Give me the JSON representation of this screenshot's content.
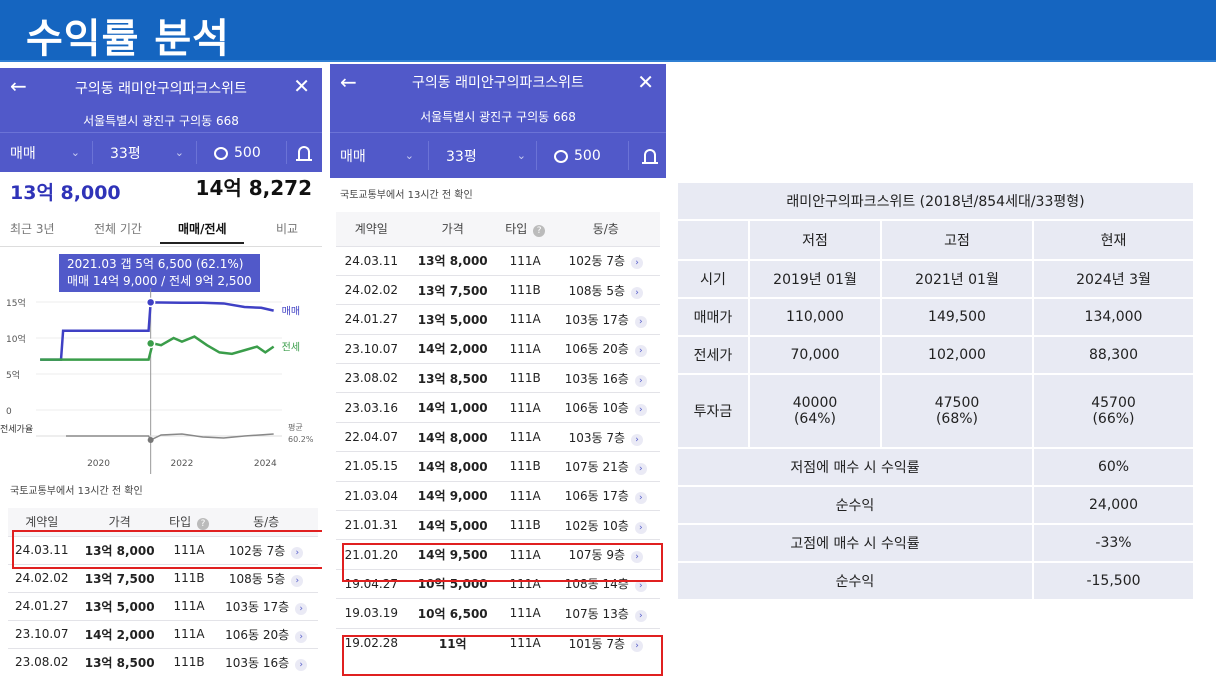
{
  "slide": {
    "title": "수익률 분석"
  },
  "left_panel": {
    "back_icon": "←",
    "close_icon": "✕",
    "complex_name": "구의동 래미안구의파크스위트",
    "address": "서울특별시 광진구 구의동 668",
    "filter_type": "매매",
    "filter_size": "33평",
    "comment_count": "500",
    "sale_price": "13억 8,000",
    "jeonse_price": "14억 8,272",
    "tabs": [
      "최근 3년",
      "전체 기간",
      "매매/전세",
      "비교"
    ],
    "tooltip_line1": "2021.03  갭 5억 6,500 (62.1%)",
    "tooltip_line2": "매매 14억 9,000 / 전세 9억 2,500",
    "source": "국토교통부에서 13시간 전 확인"
  },
  "chart_data": {
    "type": "line",
    "y_ticks": [
      "15억",
      "10억",
      "5억",
      "0"
    ],
    "x_ticks": [
      "2020",
      "2022",
      "2024"
    ],
    "ylim": [
      0,
      15
    ],
    "series": [
      {
        "name": "매매",
        "color": "#3f40c4",
        "x": [
          2018.6,
          2019.1,
          2019.15,
          2020.2,
          2020.25,
          2021.0,
          2021.2,
          2021.25,
          2022.0,
          2022.5,
          2023.0,
          2023.5,
          2023.9,
          2024.2
        ],
        "values": [
          7.0,
          7.0,
          11.0,
          11.0,
          11.0,
          11.0,
          11.0,
          14.95,
          14.9,
          14.9,
          14.8,
          14.3,
          14.2,
          13.8
        ]
      },
      {
        "name": "전세",
        "color": "#3a9d4a",
        "x": [
          2018.6,
          2019.0,
          2019.5,
          2020.0,
          2020.5,
          2021.0,
          2021.2,
          2021.3,
          2021.5,
          2021.8,
          2022.0,
          2022.3,
          2022.6,
          2022.9,
          2023.2,
          2023.5,
          2023.8,
          2024.0,
          2024.2
        ],
        "values": [
          7.0,
          7.0,
          7.0,
          7.0,
          7.0,
          7.0,
          7.0,
          9.25,
          9.0,
          10.0,
          9.5,
          10.2,
          9.0,
          8.0,
          7.8,
          8.3,
          8.8,
          8.0,
          8.8
        ]
      }
    ],
    "ratio_label": "전세가율",
    "ratio_avg_label": "평균",
    "ratio_avg_value": "60.2%"
  },
  "left_table": {
    "headers": [
      "계약일",
      "가격",
      "타입",
      "동/층"
    ],
    "rows": [
      {
        "date": "24.03.11",
        "price": "13억 8,000",
        "type": "111A",
        "unit": "102동 7층"
      },
      {
        "date": "24.02.02",
        "price": "13억 7,500",
        "type": "111B",
        "unit": "108동 5층"
      },
      {
        "date": "24.01.27",
        "price": "13억 5,000",
        "type": "111A",
        "unit": "103동 17층"
      },
      {
        "date": "23.10.07",
        "price": "14억 2,000",
        "type": "111A",
        "unit": "106동 20층"
      },
      {
        "date": "23.08.02",
        "price": "13억 8,500",
        "type": "111B",
        "unit": "103동 16층"
      }
    ]
  },
  "mid_panel": {
    "back_icon": "←",
    "close_icon": "✕",
    "complex_name": "구의동 래미안구의파크스위트",
    "address": "서울특별시 광진구 구의동 668",
    "filter_type": "매매",
    "filter_size": "33평",
    "comment_count": "500",
    "source": "국토교통부에서 13시간 전 확인",
    "headers": [
      "계약일",
      "가격",
      "타입",
      "동/층"
    ],
    "rows": [
      {
        "date": "24.03.11",
        "price": "13억 8,000",
        "type": "111A",
        "unit": "102동 7층"
      },
      {
        "date": "24.02.02",
        "price": "13억 7,500",
        "type": "111B",
        "unit": "108동 5층"
      },
      {
        "date": "24.01.27",
        "price": "13억 5,000",
        "type": "111A",
        "unit": "103동 17층"
      },
      {
        "date": "23.10.07",
        "price": "14억 2,000",
        "type": "111A",
        "unit": "106동 20층"
      },
      {
        "date": "23.08.02",
        "price": "13억 8,500",
        "type": "111B",
        "unit": "103동 16층"
      },
      {
        "date": "23.03.16",
        "price": "14억 1,000",
        "type": "111A",
        "unit": "106동 10층"
      },
      {
        "date": "22.04.07",
        "price": "14억 8,000",
        "type": "111A",
        "unit": "103동 7층"
      },
      {
        "date": "21.05.15",
        "price": "14억 8,000",
        "type": "111B",
        "unit": "107동 21층"
      },
      {
        "date": "21.03.04",
        "price": "14억 9,000",
        "type": "111A",
        "unit": "106동 17층"
      },
      {
        "date": "21.01.31",
        "price": "14억 5,000",
        "type": "111B",
        "unit": "102동 10층"
      },
      {
        "date": "21.01.20",
        "price": "14억 9,500",
        "type": "111A",
        "unit": "107동 9층"
      },
      {
        "date": "19.04.27",
        "price": "10억 5,000",
        "type": "111A",
        "unit": "108동 14층"
      },
      {
        "date": "19.03.19",
        "price": "10억 6,500",
        "type": "111A",
        "unit": "107동 13층"
      },
      {
        "date": "19.02.28",
        "price": "11억",
        "type": "111A",
        "unit": "101동 7층"
      }
    ]
  },
  "summary": {
    "title": "래미안구의파크스위트 (2018년/854세대/33평형)",
    "col_low": "저점",
    "col_high": "고점",
    "col_now": "현재",
    "row_period": {
      "label": "시기",
      "low": "2019년 01월",
      "high": "2021년 01월",
      "now": "2024년 3월"
    },
    "row_sale": {
      "label": "매매가",
      "low": "110,000",
      "high": "149,500",
      "now": "134,000"
    },
    "row_jeonse": {
      "label": "전세가",
      "low": "70,000",
      "high": "102,000",
      "now": "88,300"
    },
    "row_invest": {
      "label": "투자금",
      "low": "40000",
      "low_pct": "(64%)",
      "high": "47500",
      "high_pct": "(68%)",
      "now": "45700",
      "now_pct": "(66%)"
    },
    "buy_low_label": "저점에 매수 시 수익률",
    "buy_low_value": "60%",
    "net1_label": "순수익",
    "net1_value": "24,000",
    "buy_high_label": "고점에 매수 시 수익률",
    "buy_high_value": "-33%",
    "net2_label": "순수익",
    "net2_value": "-15,500"
  }
}
